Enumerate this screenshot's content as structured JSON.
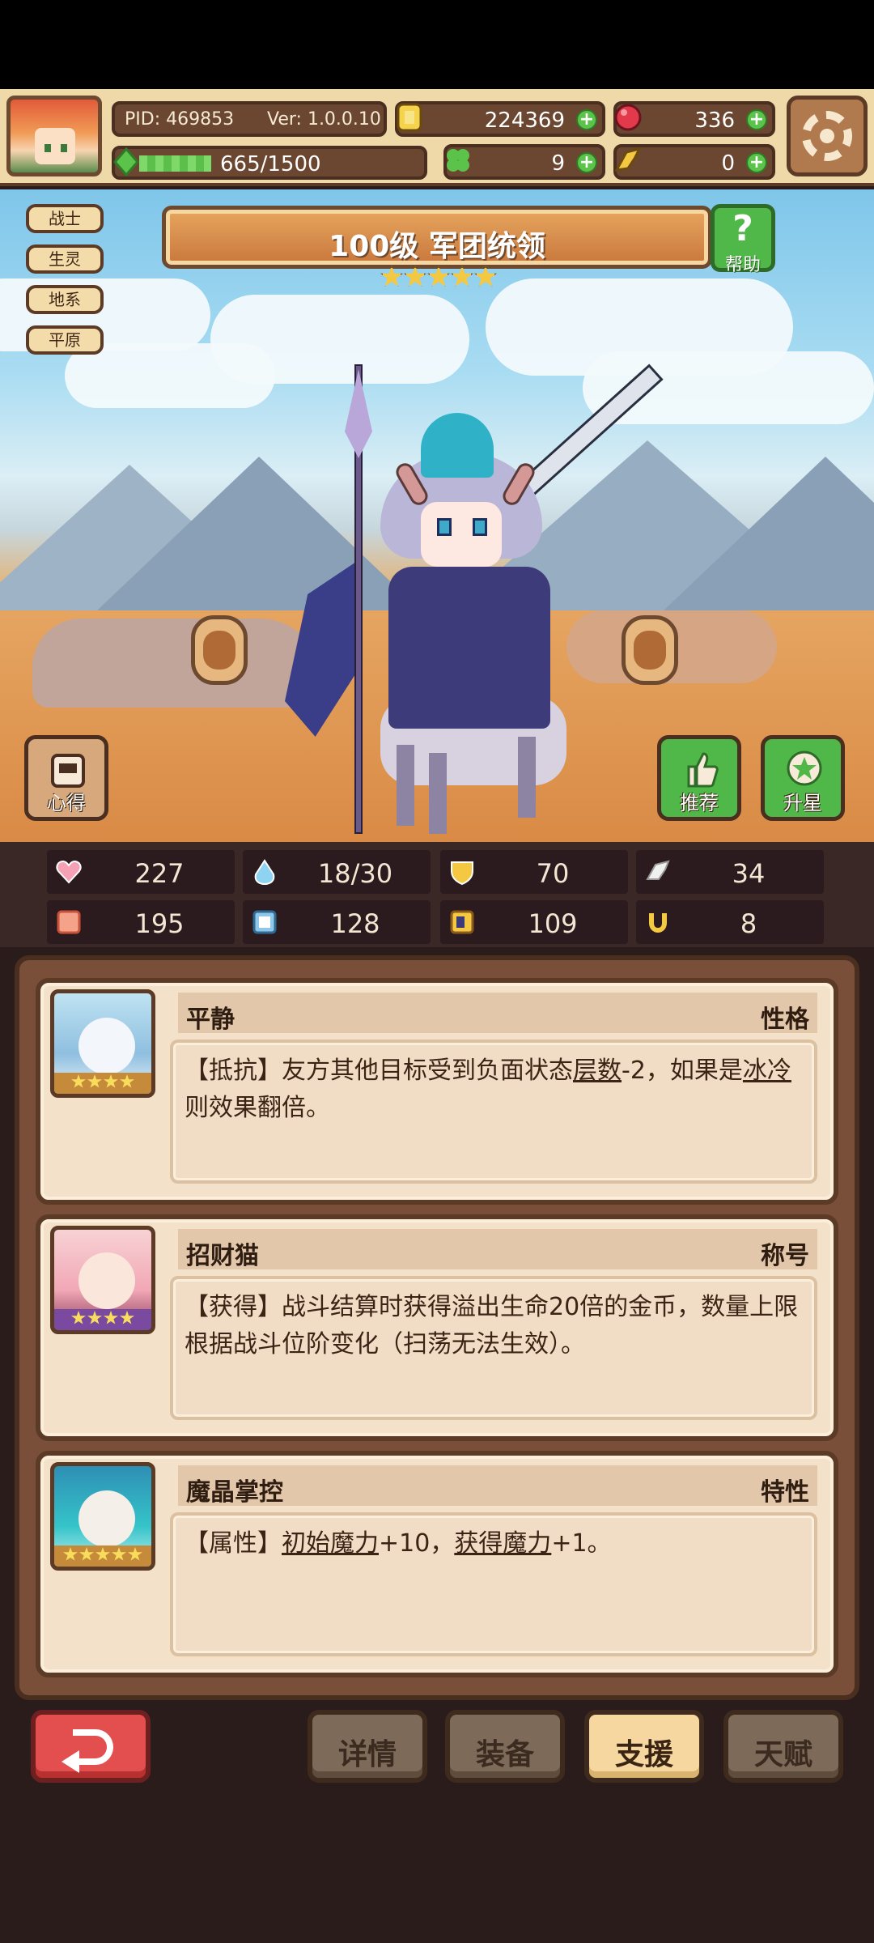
{
  "header": {
    "pid": "PID: 469853",
    "version": "Ver: 1.0.0.10",
    "gold": "224369",
    "gems": "336",
    "clovers": "9",
    "wings": "0",
    "exp_text": "665/1500",
    "exp_progress": 0.443
  },
  "tags": [
    "战士",
    "生灵",
    "地系",
    "平原"
  ],
  "hero": {
    "title": "100级 军团统领",
    "stars": 5
  },
  "buttons": {
    "help": "帮助",
    "insight": "心得",
    "recommend": "推荐",
    "star_up": "升星"
  },
  "stats": [
    {
      "icon": "heart-icon",
      "value": "227"
    },
    {
      "icon": "water-drop-icon",
      "value": "18/30"
    },
    {
      "icon": "shield-icon",
      "value": "70"
    },
    {
      "icon": "wing-icon",
      "value": "34"
    },
    {
      "icon": "fist-icon",
      "value": "195"
    },
    {
      "icon": "book-icon",
      "value": "128"
    },
    {
      "icon": "boot-icon",
      "value": "109"
    },
    {
      "icon": "horseshoe-icon",
      "value": "8"
    }
  ],
  "cards": [
    {
      "name": "平静",
      "type": "性格",
      "stars": 4,
      "pre": "【抵抗】友方其他目标受到负面状态",
      "link1": "层数",
      "mid": "-2，如果是",
      "link2": "冰冷",
      "post": "则效果翻倍。"
    },
    {
      "name": "招财猫",
      "type": "称号",
      "stars": 4,
      "text": "【获得】战斗结算时获得溢出生命20倍的金币，数量上限根据战斗位阶变化（扫荡无法生效）。"
    },
    {
      "name": "魔晶掌控",
      "type": "特性",
      "stars": 5,
      "pre": "【属性】",
      "link1": "初始魔力",
      "mid": "+10，",
      "link2": "获得魔力",
      "post": "+1。"
    }
  ],
  "tabs": [
    "详情",
    "装备",
    "支援",
    "天赋"
  ],
  "active_tab": "支援",
  "colors": {
    "accent": "#f5d79f",
    "panel": "#7a4f3a",
    "back": "#e34e4e",
    "green": "#4fb848"
  }
}
